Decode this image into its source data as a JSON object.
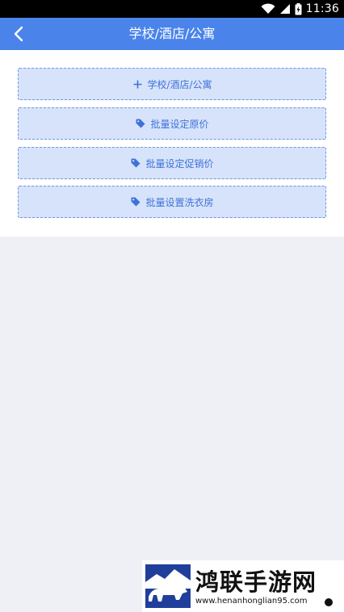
{
  "status_bar": {
    "time": "11:36"
  },
  "app_bar": {
    "title": "学校/酒店/公寓"
  },
  "actions": [
    {
      "label": "学校/酒店/公寓",
      "icon": "plus-icon"
    },
    {
      "label": "批量设定原价",
      "icon": "tag-icon"
    },
    {
      "label": "批量设定促销价",
      "icon": "tag-icon"
    },
    {
      "label": "批量设置洗衣房",
      "icon": "tag-icon"
    }
  ],
  "watermark": {
    "title": "鸿联手游网",
    "url": "www.henanhonglian95.com"
  },
  "colors": {
    "accent": "#4a84ea",
    "button_bg": "#d7e3fa",
    "button_text": "#3f72d9",
    "page_bg": "#eef0f5"
  }
}
